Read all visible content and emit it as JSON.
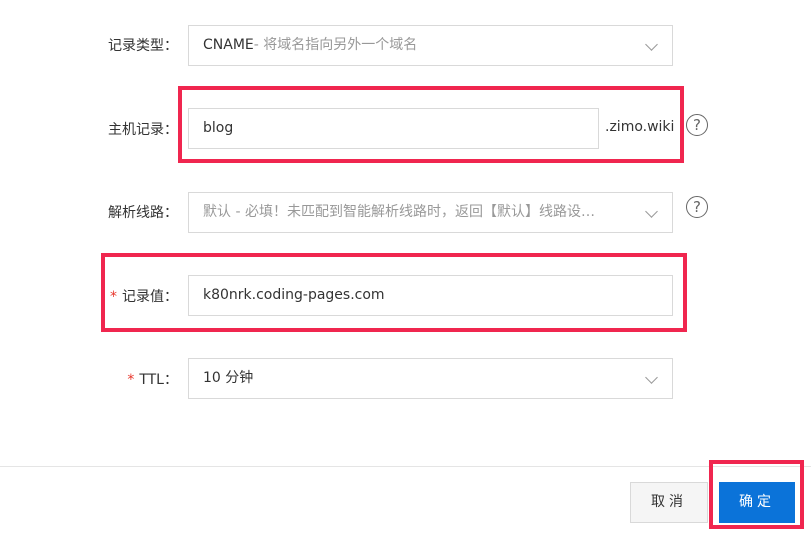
{
  "form": {
    "record_type": {
      "label": "记录类型：",
      "value_main": "CNAME",
      "value_hint": "- 将域名指向另外一个域名"
    },
    "host": {
      "label": "主机记录：",
      "value": "blog",
      "suffix": ".zimo.wiki"
    },
    "line": {
      "label": "解析线路：",
      "value": "默认 - 必填！未匹配到智能解析线路时，返回【默认】线路设…"
    },
    "record_value": {
      "required_mark": "*",
      "label": "记录值：",
      "value": "k80nrk.coding-pages.com"
    },
    "ttl": {
      "required_mark": "*",
      "label": "TTL：",
      "value": "10 分钟"
    },
    "help_glyph": "?"
  },
  "footer": {
    "cancel_label": "取消",
    "confirm_label": "确定"
  },
  "colors": {
    "highlight": "#f0264f",
    "primary": "#0b73d9",
    "required": "#e8352b"
  }
}
